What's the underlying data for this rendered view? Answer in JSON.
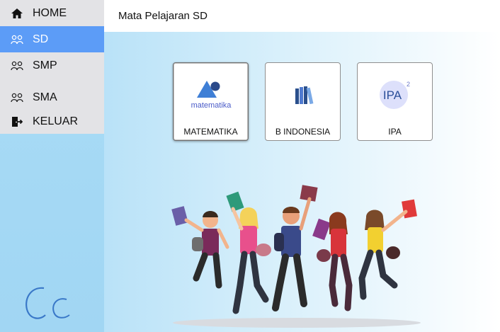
{
  "sidebar": {
    "items": [
      {
        "label": "HOME",
        "icon": "home-icon"
      },
      {
        "label": "SD",
        "icon": "students-icon"
      },
      {
        "label": "SMP",
        "icon": "students-icon"
      },
      {
        "label": "SMA",
        "icon": "students-icon"
      },
      {
        "label": "KELUAR",
        "icon": "logout-icon"
      }
    ],
    "active_index": 1
  },
  "header": {
    "title": "Mata Pelajaran SD"
  },
  "subjects": [
    {
      "label": "MATEMATIKA",
      "logo_text": "matematika"
    },
    {
      "label": "B INDONESIA"
    },
    {
      "label": "IPA",
      "logo_text": "IPA",
      "logo_sup": "2"
    }
  ],
  "colors": {
    "active_menu": "#5c9cf7",
    "sidebar_bg": "#a9dcf6",
    "menu_bg": "#e3e3e6"
  }
}
